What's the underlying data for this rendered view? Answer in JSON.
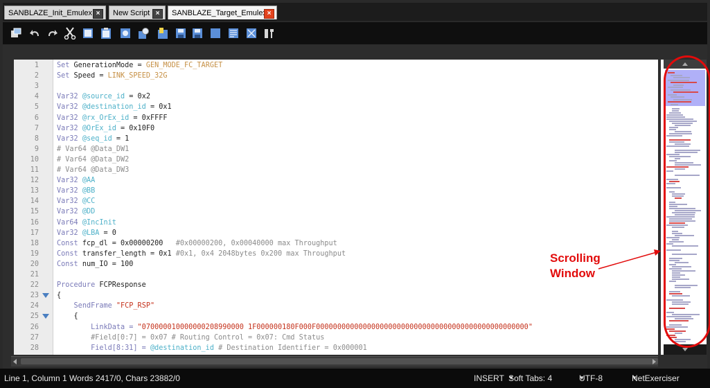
{
  "tabs": [
    {
      "label": "SANBLAZE_Init_Emulex",
      "active": false
    },
    {
      "label": "New Script",
      "active": false
    },
    {
      "label": "SANBLAZE_Target_Emulex",
      "active": true
    }
  ],
  "toolbar": {
    "icons": [
      "open-window-icon",
      "undo-icon",
      "redo-icon",
      "cut-icon",
      "copy-icon",
      "paste-icon",
      "find-icon",
      "search-replace-icon",
      "compile-icon",
      "save-icon",
      "save-all-icon",
      "close-file-icon",
      "document-icon",
      "fullscreen-icon",
      "settings-icon"
    ]
  },
  "code_lines": [
    {
      "n": "1",
      "parts": [
        [
          "kw",
          "Set "
        ],
        [
          "plain",
          "GenerationMode = "
        ],
        [
          "const",
          "GEN_MODE_FC_TARGET"
        ]
      ]
    },
    {
      "n": "2",
      "parts": [
        [
          "kw",
          "Set "
        ],
        [
          "plain",
          "Speed = "
        ],
        [
          "const",
          "LINK_SPEED_32G"
        ]
      ]
    },
    {
      "n": "3",
      "parts": []
    },
    {
      "n": "4",
      "parts": [
        [
          "kw",
          "Var32 "
        ],
        [
          "var",
          "@source_id"
        ],
        [
          "plain",
          " = 0x2"
        ]
      ]
    },
    {
      "n": "5",
      "parts": [
        [
          "kw",
          "Var32 "
        ],
        [
          "var",
          "@destination_id"
        ],
        [
          "plain",
          " = 0x1"
        ]
      ]
    },
    {
      "n": "6",
      "parts": [
        [
          "kw",
          "Var32 "
        ],
        [
          "var",
          "@rx_OrEx_id"
        ],
        [
          "plain",
          " = 0xFFFF"
        ]
      ]
    },
    {
      "n": "7",
      "parts": [
        [
          "kw",
          "Var32 "
        ],
        [
          "var",
          "@OrEx_id"
        ],
        [
          "plain",
          " = 0x10F0"
        ]
      ]
    },
    {
      "n": "8",
      "parts": [
        [
          "kw",
          "Var32 "
        ],
        [
          "var",
          "@seq_id"
        ],
        [
          "plain",
          " = 1"
        ]
      ]
    },
    {
      "n": "9",
      "parts": [
        [
          "cmt",
          "# Var64 @Data_DW1"
        ]
      ]
    },
    {
      "n": "10",
      "parts": [
        [
          "cmt",
          "# Var64 @Data_DW2"
        ]
      ]
    },
    {
      "n": "11",
      "parts": [
        [
          "cmt",
          "# Var64 @Data_DW3"
        ]
      ]
    },
    {
      "n": "12",
      "parts": [
        [
          "kw",
          "Var32 "
        ],
        [
          "var",
          "@AA"
        ]
      ]
    },
    {
      "n": "13",
      "parts": [
        [
          "kw",
          "Var32 "
        ],
        [
          "var",
          "@BB"
        ]
      ]
    },
    {
      "n": "14",
      "parts": [
        [
          "kw",
          "Var32 "
        ],
        [
          "var",
          "@CC"
        ]
      ]
    },
    {
      "n": "15",
      "parts": [
        [
          "kw",
          "Var32 "
        ],
        [
          "var",
          "@DD"
        ]
      ]
    },
    {
      "n": "16",
      "parts": [
        [
          "kw",
          "Var64 "
        ],
        [
          "var",
          "@IncInit"
        ]
      ]
    },
    {
      "n": "17",
      "parts": [
        [
          "kw",
          "Var32 "
        ],
        [
          "var",
          "@LBA"
        ],
        [
          "plain",
          " = 0"
        ]
      ]
    },
    {
      "n": "18",
      "parts": [
        [
          "kw",
          "Const "
        ],
        [
          "plain",
          "fcp_dl = 0x00000200   "
        ],
        [
          "cmt",
          "#0x00000200, 0x00040000 max Throughput"
        ]
      ]
    },
    {
      "n": "19",
      "parts": [
        [
          "kw",
          "Const "
        ],
        [
          "plain",
          "transfer_length = 0x1 "
        ],
        [
          "cmt",
          "#0x1, 0x4 2048bytes 0x200 max Throughput"
        ]
      ]
    },
    {
      "n": "20",
      "parts": [
        [
          "kw",
          "Const "
        ],
        [
          "plain",
          "num_IO = 100"
        ]
      ]
    },
    {
      "n": "21",
      "parts": []
    },
    {
      "n": "22",
      "parts": [
        [
          "kw",
          "Procedure "
        ],
        [
          "plain",
          "FCPResponse"
        ]
      ]
    },
    {
      "n": "23",
      "fold": true,
      "parts": [
        [
          "plain",
          "{"
        ]
      ]
    },
    {
      "n": "24",
      "parts": [
        [
          "plain",
          "    "
        ],
        [
          "kw",
          "SendFrame "
        ],
        [
          "str",
          "\"FCP_RSP\""
        ]
      ]
    },
    {
      "n": "25",
      "fold": true,
      "parts": [
        [
          "plain",
          "    {"
        ]
      ]
    },
    {
      "n": "26",
      "parts": [
        [
          "plain",
          "        "
        ],
        [
          "kw",
          "LinkData = "
        ],
        [
          "str",
          "\"070000010000000208990000 1F000000180F000F00000000000000000000000000000000000000000000000000\""
        ]
      ]
    },
    {
      "n": "27",
      "parts": [
        [
          "plain",
          "        "
        ],
        [
          "cmt",
          "#Field[0:7] = 0x07 # Routing Control = 0x07: Cmd Status"
        ]
      ]
    },
    {
      "n": "28",
      "parts": [
        [
          "plain",
          "        "
        ],
        [
          "kw",
          "Field[8:31] = "
        ],
        [
          "var",
          "@destination_id"
        ],
        [
          "cmt",
          " # Destination Identifier = 0x000001"
        ]
      ]
    }
  ],
  "annotation": {
    "line1": "Scrolling",
    "line2": "Window"
  },
  "status": {
    "position": "Line 1, Column 1 Words 2417/0, Chars 23882/0",
    "mode": "INSERT",
    "tabs": "Soft Tabs: 4",
    "encoding": "UTF-8",
    "language": "NetExerciser"
  }
}
